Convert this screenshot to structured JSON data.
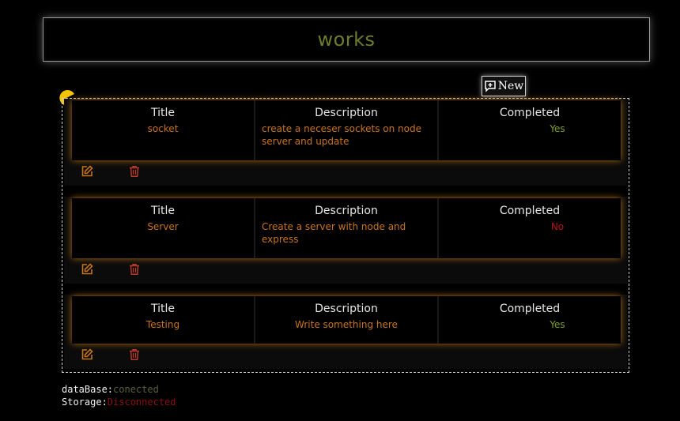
{
  "header": {
    "title": "works"
  },
  "toolbar": {
    "new_label": "New",
    "new_icon": "add-comment-icon"
  },
  "columns": {
    "title": "Title",
    "description": "Description",
    "completed": "Completed"
  },
  "tasks": [
    {
      "title": "socket",
      "description": "create a neceser sockets on node server and update",
      "completed": "Yes"
    },
    {
      "title": "Server",
      "description": "Create a server with node and express",
      "completed": "No"
    },
    {
      "title": "Testing",
      "description": "Write something here",
      "completed": "Yes"
    }
  ],
  "status": {
    "database_label": "dataBase:",
    "database_value": "conected",
    "storage_label": "Storage:",
    "storage_value": "Disconnected"
  },
  "colors": {
    "title_green": "#6d7d2b",
    "accent_orange": "#c7741c",
    "yes_green": "#7f9a2e",
    "no_red": "#b41414",
    "delete_red": "#b73a2a",
    "pacman_yellow": "#f5c400"
  }
}
